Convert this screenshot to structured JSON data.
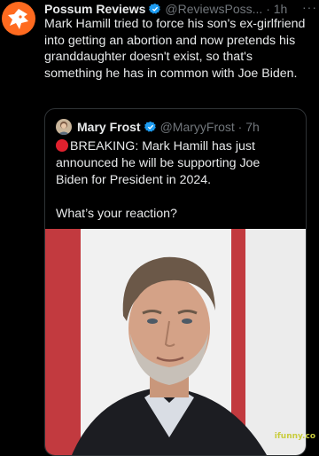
{
  "tweet": {
    "display_name": "Possum Reviews",
    "handle_time": "@ReviewsPoss... · 1h",
    "more_label": "···",
    "text": "Mark Hamill tried to force his son's ex-girlfriend into getting an abortion and now pretends his granddaughter doesn't exist, so that's something he has in common with Joe Biden."
  },
  "quoted_tweet": {
    "display_name": "Mary Frost",
    "handle_time": "@MaryyFrost · 7h",
    "line1": "BREAKING: Mark Hamill has just announced he will be supporting Joe Biden for President in 2024.",
    "line2": "What’s your reaction?"
  },
  "watermark": "ifunny.co",
  "colors": {
    "verified": "#1d9bf0",
    "avatar_bg": "#ff6a1f",
    "alert_dot": "#e0212e"
  }
}
